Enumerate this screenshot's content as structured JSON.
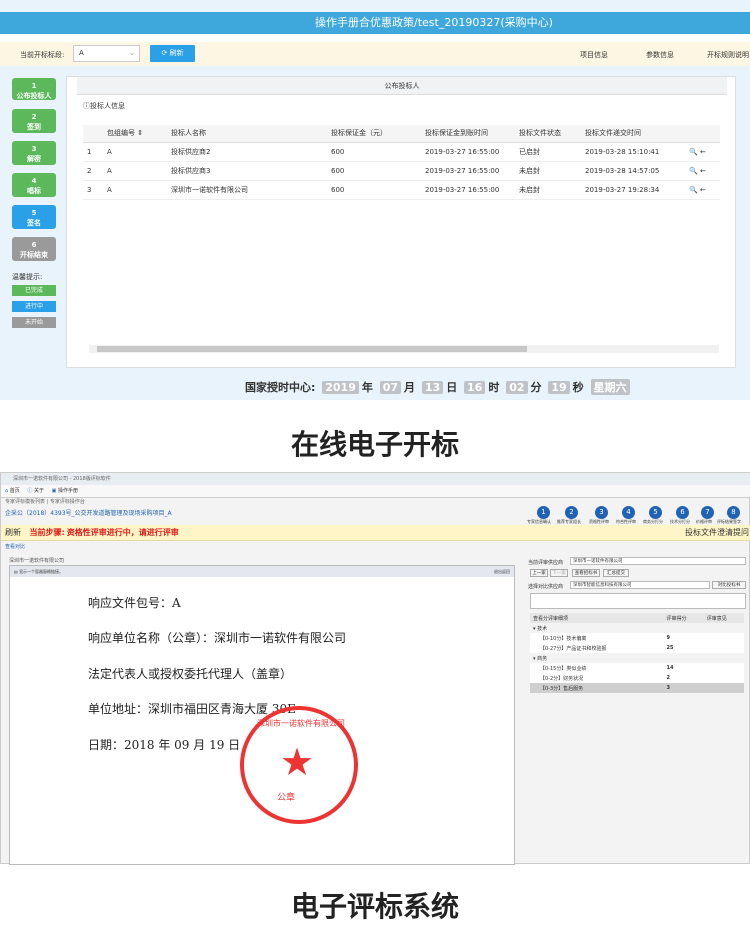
{
  "top": {
    "title": "操作手册合优惠政策/test_20190327(采购中心)",
    "section_label": "当前开标标段:",
    "section_value": "A",
    "refresh": "刷新",
    "links": [
      "项目信息",
      "参数信息",
      "开标规则说明"
    ],
    "steps": [
      {
        "num": "1",
        "label": "公布投标人",
        "color": "#5bb85b"
      },
      {
        "num": "2",
        "label": "签到",
        "color": "#5bb85b"
      },
      {
        "num": "3",
        "label": "解密",
        "color": "#5bb85b"
      },
      {
        "num": "4",
        "label": "唱标",
        "color": "#5bb85b"
      },
      {
        "num": "5",
        "label": "签名",
        "color": "#29a0e8"
      },
      {
        "num": "6",
        "label": "开标结束",
        "color": "#9a9a9a"
      }
    ],
    "legend_title": "温馨提示:",
    "legend": [
      {
        "label": "已完成",
        "color": "#5bb85b"
      },
      {
        "label": "进行中",
        "color": "#29a0e8"
      },
      {
        "label": "未开始",
        "color": "#9a9a9a"
      }
    ],
    "panel_title": "公布投标人",
    "sub_title": "投标人信息",
    "columns": [
      "",
      "包组编号",
      "投标人名称",
      "投标保证金（元）",
      "投标保证金到账时间",
      "投标文件状态",
      "投标文件递交时间",
      ""
    ],
    "rows": [
      [
        "1",
        "A",
        "投标供应商2",
        "600",
        "2019-03-27 16:55:00",
        "已启封",
        "2019-03-28 15:10:41",
        "🔍 ←"
      ],
      [
        "2",
        "A",
        "投标供应商3",
        "600",
        "2019-03-27 16:55:00",
        "未启封",
        "2019-03-28 14:57:05",
        "🔍 ←"
      ],
      [
        "3",
        "A",
        "深圳市一诺软件有限公司",
        "600",
        "2019-03-27 16:55:00",
        "未启封",
        "2019-03-27 19:28:34",
        "🔍 ←"
      ]
    ],
    "clock": {
      "label": "国家授时中心:",
      "year": "2019",
      "year_u": "年",
      "month": "07",
      "month_u": "月",
      "day": "13",
      "day_u": "日",
      "hour": "16",
      "hour_u": "时",
      "minute": "02",
      "minute_u": "分",
      "second": "19",
      "second_u": "秒",
      "weekday": "星期六"
    }
  },
  "caption1": "在线电子开标",
  "bottom": {
    "window_title": "深圳市一诺软件有限公司 - 2018版评标软件",
    "tabs": [
      "首页",
      "关于",
      "操作手册"
    ],
    "breadcrumb": "专家评标模板列表 | 专家评标操作台",
    "project": "企采公（2018）4393号_公交开发道路管理及现场采购项目_A",
    "steps": [
      "专家信息确认",
      "推荐专家组长",
      "资格性评审",
      "符合性评审",
      "商务分打分",
      "技术分打分",
      "价格评审",
      "评标结果签字"
    ],
    "refresh": "刷新",
    "current_step_label": "当前步骤:",
    "current_step": "资格性评审进行中，请进行评审",
    "top_right": "投标文件澄清提问",
    "small_info": "查看对比",
    "supplier_label": "深圳市一诺软件有限公司",
    "doc_toolbar": "显示一个容器窗格链接。",
    "doc_toolbar_right": "退出返回",
    "doc_lines": [
      "响应文件包号：A",
      "响应单位名称（公章）：深圳市一诺软件有限公司",
      "法定代表人或授权委托代理人（盖章）",
      "单位地址：深圳市福田区青海大厦 30E",
      "日期：2018 年 09 月 19 日"
    ],
    "seal_ring": "深圳市一诺软件有限公司",
    "seal_text": "公章",
    "rp": {
      "current_label": "当前评审供应商",
      "current_value": "深圳市一诺软件有限公司",
      "prev": "上一家",
      "next": "下一家",
      "btn_view": "查看招标书",
      "btn_submit": "汇总提交",
      "compare_label": "选择对比供应商",
      "compare_value": "深圳市智能信息科技有限公司",
      "compare_btn": "对比投标书",
      "head_item": "查看分评审细项",
      "head_score": "评审得分",
      "head_opinion": "评审意见",
      "groups": [
        {
          "name": "技术",
          "items": [
            [
              "【0-10分】技术偏离",
              "9"
            ],
            [
              "【0-27分】产品证书和校验报",
              "25"
            ]
          ]
        },
        {
          "name": "商务",
          "items": [
            [
              "【0-15分】类似业绩",
              "14"
            ],
            [
              "【0-2分】财务状况",
              "2"
            ],
            [
              "【0-3分】售后服务",
              "3"
            ]
          ]
        }
      ]
    }
  },
  "caption2": "电子评标系统"
}
